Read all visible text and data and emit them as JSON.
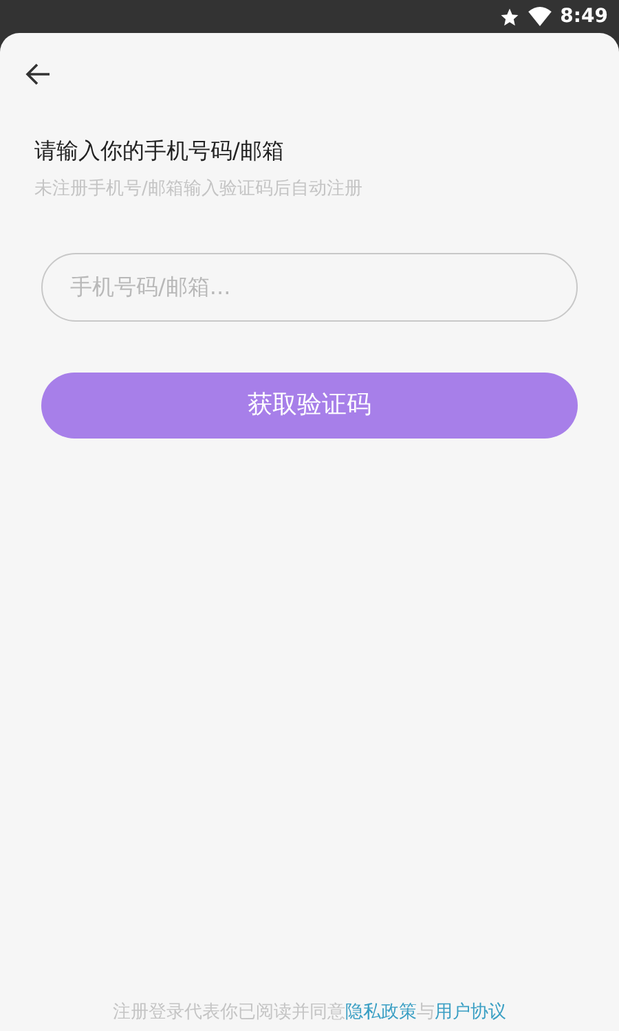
{
  "status_bar": {
    "time": "8:49"
  },
  "title": "请输入你的手机号码/邮箱",
  "subtitle": "未注册手机号/邮箱输入验证码后自动注册",
  "input": {
    "placeholder": "手机号码/邮箱..."
  },
  "submit_button": {
    "label": "获取验证码",
    "disabled": true
  },
  "agreement": {
    "text": "注册登录代表你已阅读并同意",
    "links": [
      "隐私政策",
      "用户协议"
    ],
    "joiner": "与"
  }
}
